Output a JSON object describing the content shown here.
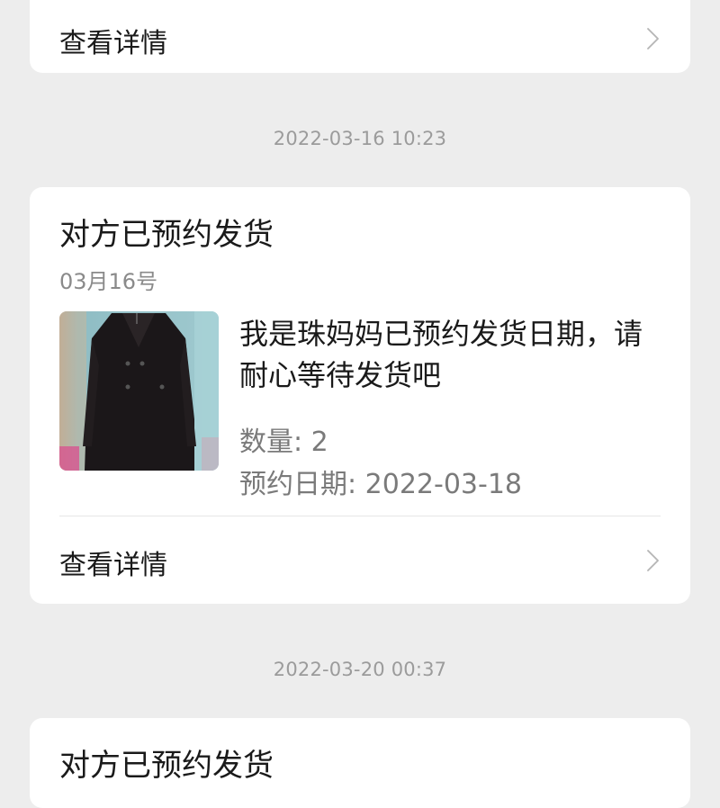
{
  "cards": [
    {
      "detail_label": "查看详情"
    },
    {
      "timestamp": "2022-03-16 10:23",
      "title": "对方已预约发货",
      "date": "03月16号",
      "message": "我是珠妈妈已预约发货日期，请耐心等待发货吧",
      "quantity": "数量: 2",
      "reserved_date": "预约日期: 2022-03-18",
      "detail_label": "查看详情",
      "thumbnail_icon": "black-coat-photo"
    },
    {
      "timestamp": "2022-03-20 00:37",
      "title": "对方已预约发货"
    }
  ],
  "colors": {
    "background": "#ededed",
    "card": "#ffffff",
    "timestamp": "#9b9b9b",
    "secondary_text": "#7a7a7a"
  }
}
